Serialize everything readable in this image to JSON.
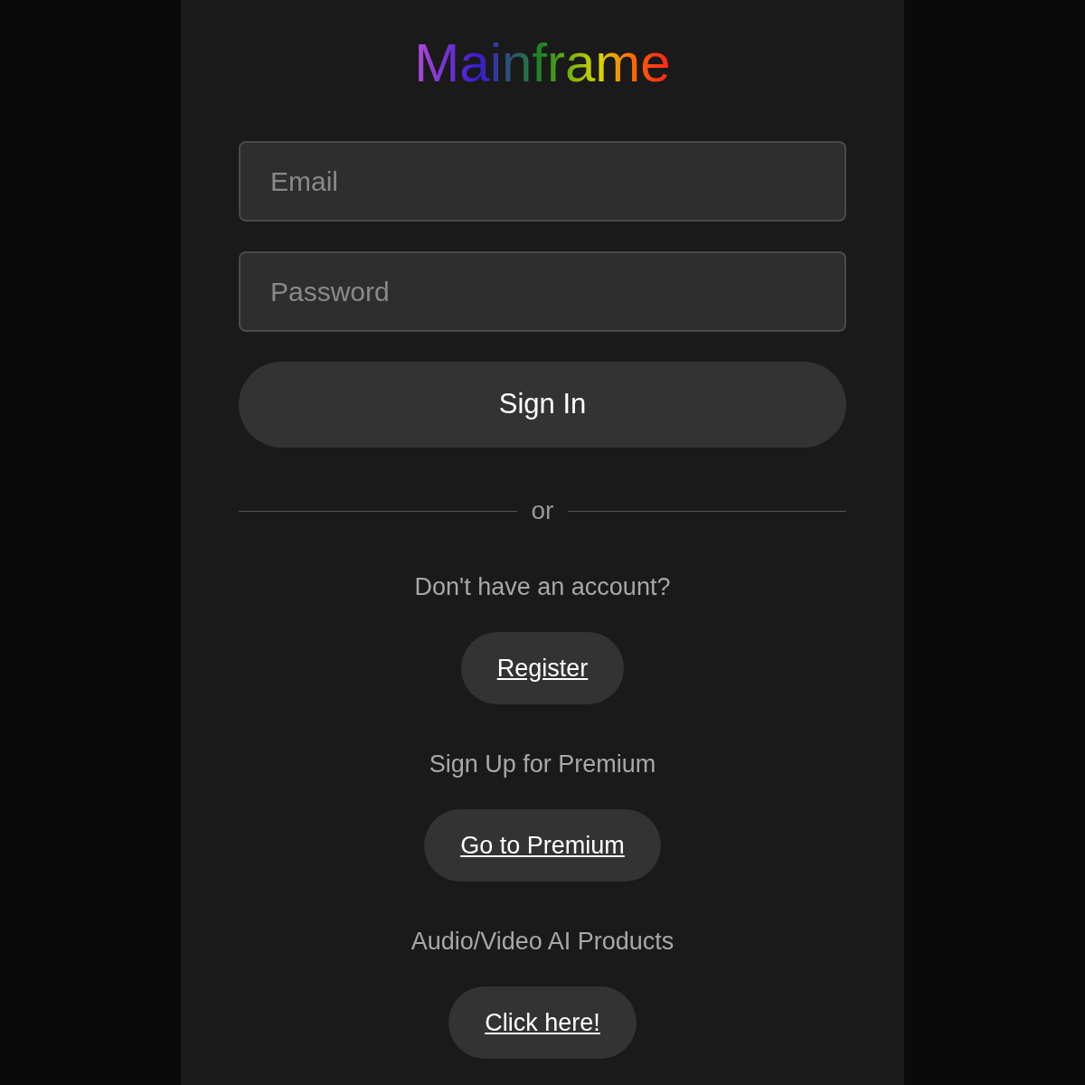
{
  "logo": {
    "text": "Mainframe"
  },
  "fields": [
    {
      "placeholder": "Email"
    },
    {
      "placeholder": "Password"
    }
  ],
  "sign_in": {
    "label": "Sign In"
  },
  "divider": {
    "text": "or"
  },
  "sections": [
    {
      "prompt": "Don't have an account?",
      "link": "Register"
    },
    {
      "prompt": "Sign Up for Premium",
      "link": "Go to Premium"
    },
    {
      "prompt": "Audio/Video AI Products",
      "link": "Click here!"
    }
  ]
}
